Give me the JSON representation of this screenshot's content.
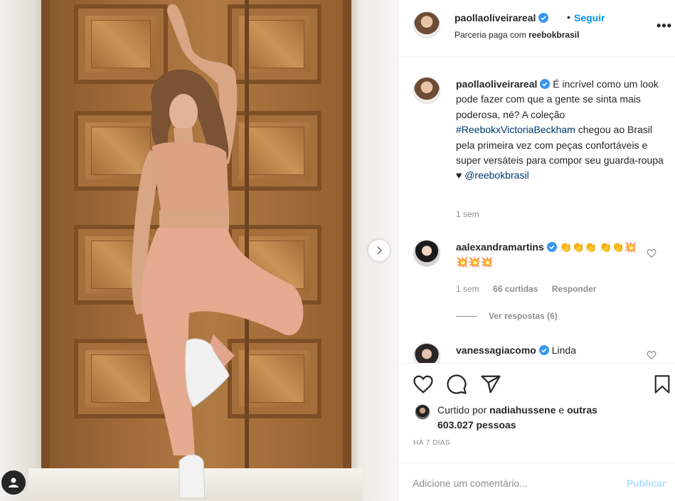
{
  "header": {
    "username": "paollaoliveirareal",
    "separator": "•",
    "follow_label": "Seguir",
    "partnership_prefix": "Parceria paga com",
    "partner": "reebokbrasil",
    "more_label": "•••"
  },
  "caption": {
    "username": "paollaoliveirareal",
    "text_1": " É incrível como um look pode fazer com que a gente se sinta mais poderosa, né? A coleção ",
    "hashtag": "#ReebokxVictoriaBeckham",
    "text_2": " chegou ao Brasil pela primeira vez com peças confortáveis e super versáteis para compor seu guarda-roupa ♥ ",
    "mention": "@reebokbrasil",
    "time": "1 sem"
  },
  "comments": [
    {
      "username": "aalexandramartins",
      "text": "👏👏👏 👏👏💥💥💥💥",
      "time": "1 sem",
      "likes": "66 curtidas",
      "reply_label": "Responder",
      "view_replies": "Ver respostas (6)"
    },
    {
      "username": "vanessagiacomo",
      "text": "Linda"
    }
  ],
  "likes": {
    "prefix": "Curtido por",
    "user": "nadiahussene",
    "middle": "e",
    "others": "outras 603.027 pessoas"
  },
  "posted": "HÁ 7 DIAS",
  "comment_box": {
    "placeholder": "Adicione um comentário...",
    "publish_label": "Publicar"
  },
  "colors": {
    "accent": "#0095f6",
    "link": "#00376b",
    "muted": "#8e8e8e",
    "publish_disabled": "#b2dffc"
  }
}
